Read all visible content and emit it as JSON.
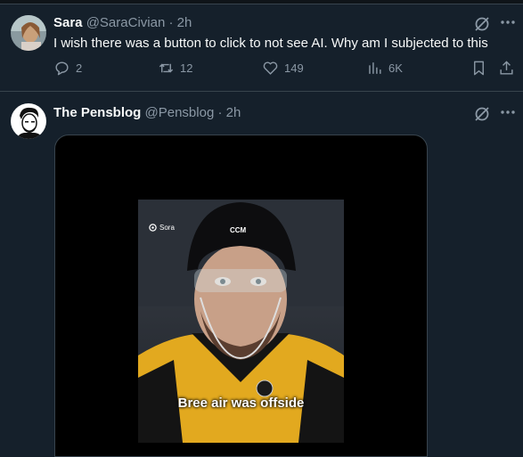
{
  "tweets": [
    {
      "name": "Sara",
      "handle": "@SaraCivian",
      "separator": "·",
      "time": "2h",
      "text": "I wish there was a button to click to not see AI. Why am I subjected to this",
      "stats": {
        "replies": "2",
        "reposts": "12",
        "likes": "149",
        "views": "6K"
      }
    },
    {
      "name": "The Pensblog",
      "handle": "@Pensblog",
      "separator": "·",
      "time": "2h",
      "media": {
        "watermark": "Sora",
        "caption": "Bree air was offside"
      }
    }
  ],
  "icons": {
    "reply": "reply-icon",
    "repost": "repost-icon",
    "like": "heart-icon",
    "views": "views-icon",
    "bookmark": "bookmark-icon",
    "share": "share-icon",
    "grok": "grok-icon",
    "more": "more-icon"
  },
  "colors": {
    "background": "#15202b",
    "muted": "#8b98a5",
    "text": "#f7f9f9"
  }
}
